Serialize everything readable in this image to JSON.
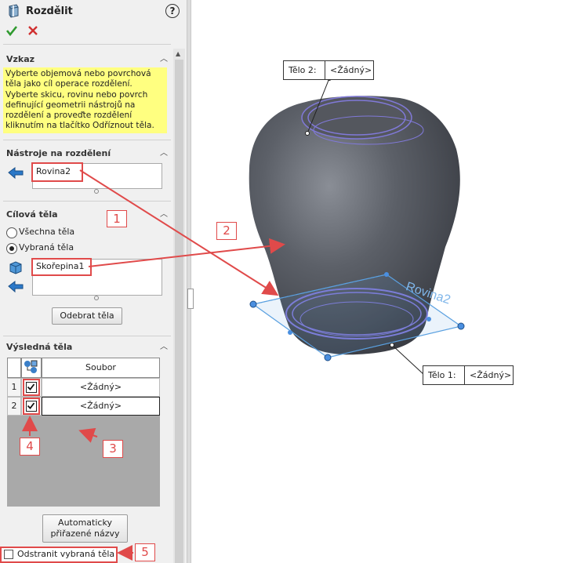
{
  "header": {
    "title": "Rozdělit"
  },
  "sections": {
    "message": {
      "title": "Vzkaz",
      "text": "Vyberte objemová nebo povrchová těla jako cíl operace rozdělení. Vyberte skicu, rovinu nebo povrch definující geometrii nástrojů na rozdělení a proveďte rozdělení kliknutím na tlačítko Odříznout těla."
    },
    "tools": {
      "title": "Nástroje na rozdělení",
      "item": "Rovina2"
    },
    "targets": {
      "title": "Cílová těla",
      "all_label": "Všechna těla",
      "selected_label": "Vybraná těla",
      "item": "Skořepina1",
      "cut_button": "Odebrat těla"
    },
    "results": {
      "title": "Výsledná těla",
      "column_file": "Soubor",
      "rows": [
        {
          "index": "1",
          "file": "<Žádný>",
          "checked": true
        },
        {
          "index": "2",
          "file": "<Žádný>",
          "checked": true
        }
      ],
      "auto_button_line1": "Automaticky",
      "auto_button_line2": "přiřazené názvy",
      "remove_label": "Odstranit vybraná těla"
    }
  },
  "annotations": {
    "n1": "1",
    "n2": "2",
    "n3": "3",
    "n4": "4",
    "n5": "5"
  },
  "viewport": {
    "tag_body2": {
      "label": "Tělo 2:",
      "value": "<Žádný>"
    },
    "tag_body1": {
      "label": "Tělo 1:",
      "value": "<Žádný>"
    },
    "plane_label": "Rovina2"
  },
  "colors": {
    "accent_red": "#e04a4a",
    "message_bg": "#ffff80",
    "plane_blue": "#5aa0e0"
  }
}
